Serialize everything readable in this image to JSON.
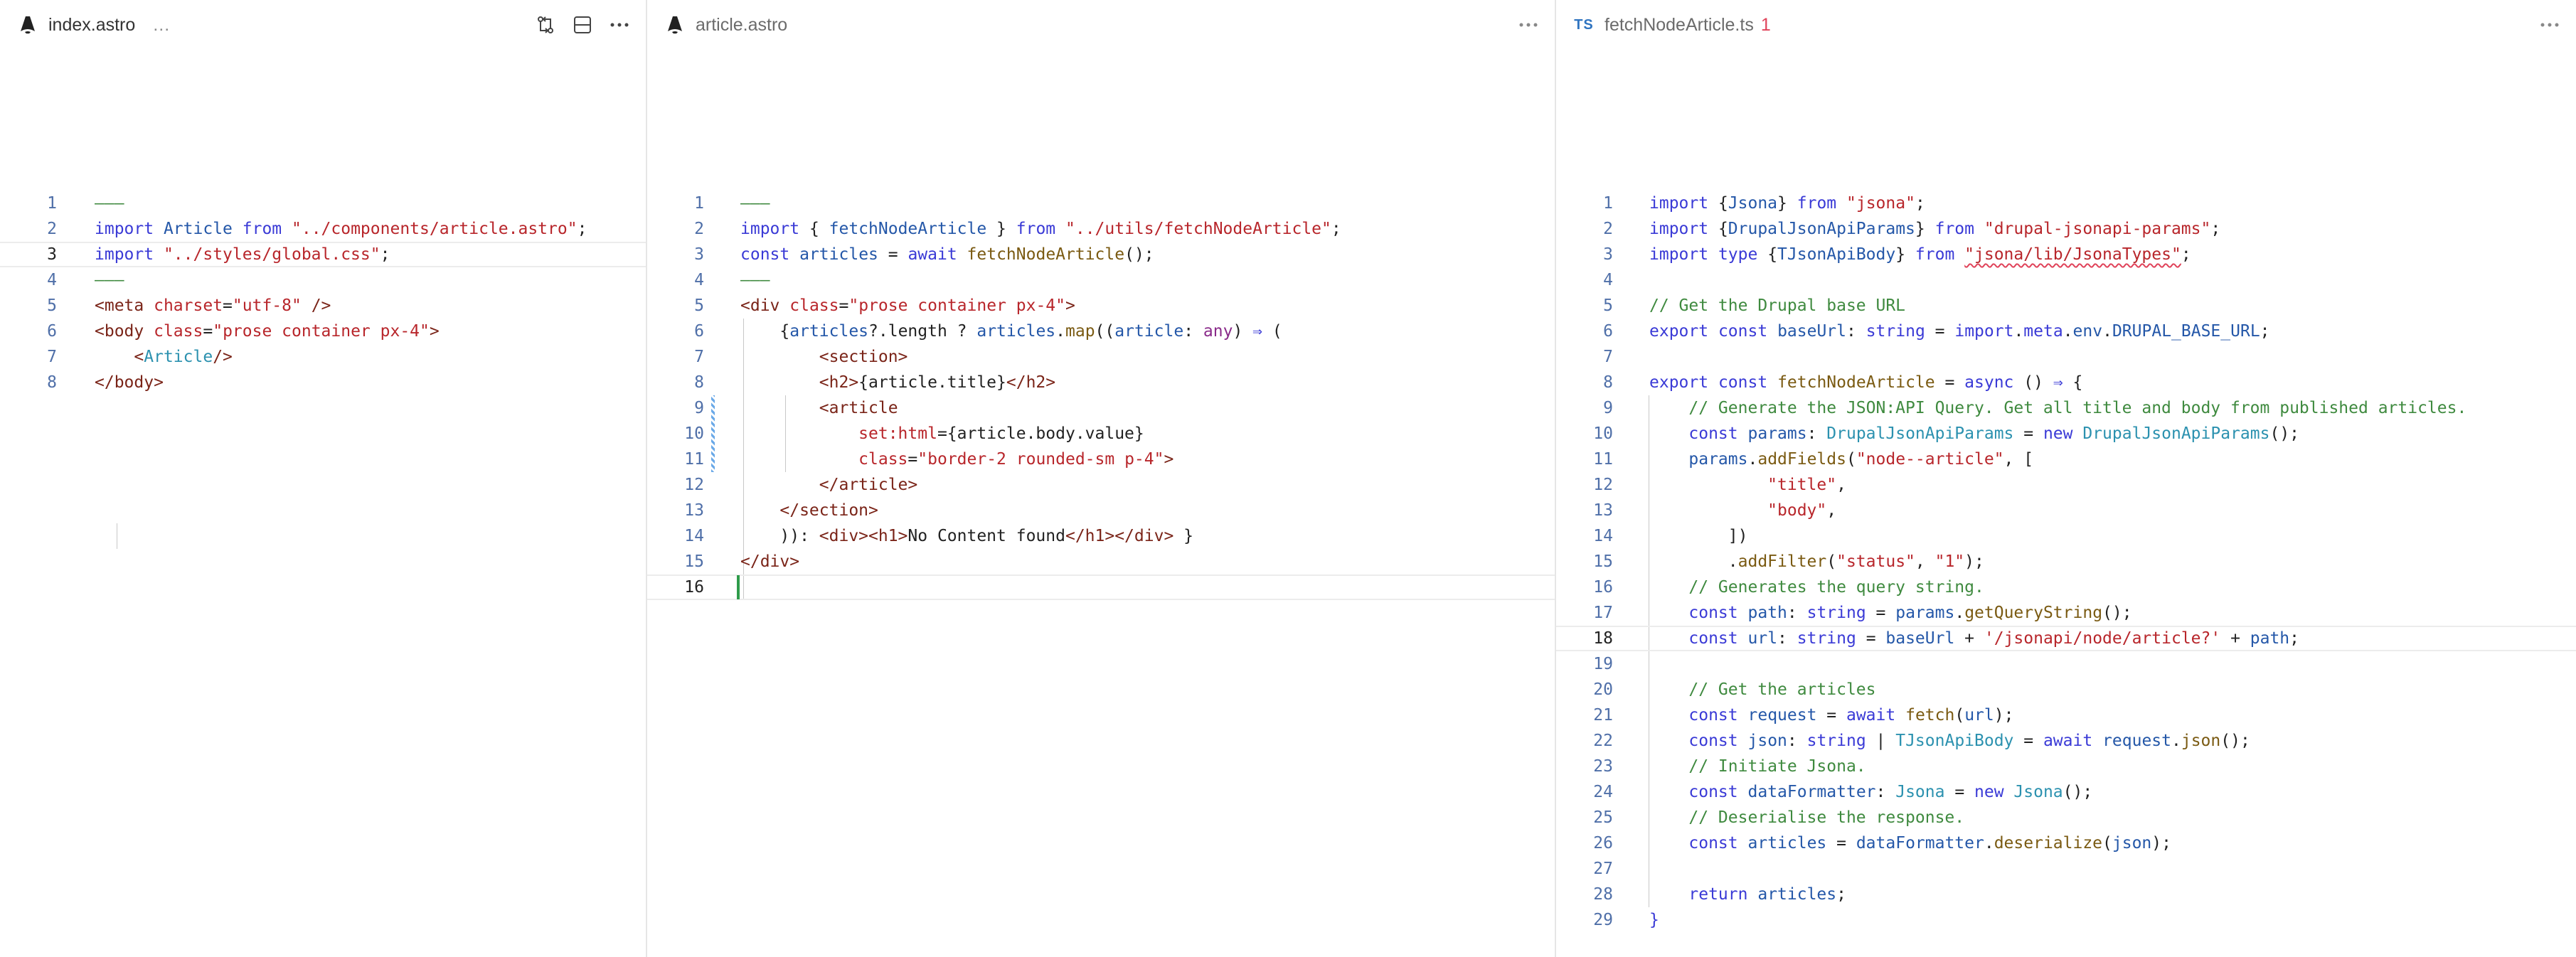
{
  "panes": [
    {
      "tab": {
        "title": "index.astro",
        "ellipsis": "…",
        "icon": "astro-icon"
      },
      "actions": [
        "source-control-compare-icon",
        "split-editor-icon",
        "more-actions-icon"
      ],
      "lines": [
        {
          "n": "1",
          "t": "———"
        },
        {
          "n": "2",
          "t": "import Article from \"../components/article.astro\";"
        },
        {
          "n": "3",
          "t": "import \"../styles/global.css\";"
        },
        {
          "n": "4",
          "t": "———"
        },
        {
          "n": "5",
          "t": "<meta charset=\"utf-8\" />"
        },
        {
          "n": "6",
          "t": "<body class=\"prose container px-4\">"
        },
        {
          "n": "7",
          "t": "    <Article/>"
        },
        {
          "n": "8",
          "t": "</body>"
        }
      ]
    },
    {
      "tab": {
        "title": "article.astro",
        "icon": "astro-icon"
      },
      "actions": [
        "more-actions-icon"
      ],
      "lines": [
        {
          "n": "1",
          "t": "———"
        },
        {
          "n": "2",
          "t": "import { fetchNodeArticle } from \"../utils/fetchNodeArticle\";"
        },
        {
          "n": "3",
          "t": "const articles = await fetchNodeArticle();"
        },
        {
          "n": "4",
          "t": "———"
        },
        {
          "n": "5",
          "t": "<div class=\"prose container px-4\">"
        },
        {
          "n": "6",
          "t": "    {articles?.length ? articles.map((article: any) ⇒ ("
        },
        {
          "n": "7",
          "t": "        <section>"
        },
        {
          "n": "8",
          "t": "        <h2>{article.title}</h2>"
        },
        {
          "n": "9",
          "t": "        <article"
        },
        {
          "n": "10",
          "t": "            set:html={article.body.value}"
        },
        {
          "n": "11",
          "t": "            class=\"border-2 rounded-sm p-4\">"
        },
        {
          "n": "12",
          "t": "        </article>"
        },
        {
          "n": "13",
          "t": "    </section>"
        },
        {
          "n": "14",
          "t": "    )): <div><h1>No Content found</h1></div> }"
        },
        {
          "n": "15",
          "t": "</div>"
        },
        {
          "n": "16",
          "t": ""
        }
      ]
    },
    {
      "tab": {
        "title": "fetchNodeArticle.ts",
        "badge": "TS",
        "problems": "1"
      },
      "actions": [
        "more-actions-icon"
      ],
      "lines": [
        {
          "n": "1",
          "t": "import {Jsona} from \"jsona\";"
        },
        {
          "n": "2",
          "t": "import {DrupalJsonApiParams} from \"drupal-jsonapi-params\";"
        },
        {
          "n": "3",
          "t": "import type {TJsonApiBody} from \"jsona/lib/JsonaTypes\";"
        },
        {
          "n": "4",
          "t": ""
        },
        {
          "n": "5",
          "t": "// Get the Drupal base URL"
        },
        {
          "n": "6",
          "t": "export const baseUrl: string = import.meta.env.DRUPAL_BASE_URL;"
        },
        {
          "n": "7",
          "t": ""
        },
        {
          "n": "8",
          "t": "export const fetchNodeArticle = async () ⇒ {"
        },
        {
          "n": "9",
          "t": "    // Generate the JSON:API Query. Get all title and body from published articles."
        },
        {
          "n": "10",
          "t": "    const params: DrupalJsonApiParams = new DrupalJsonApiParams();"
        },
        {
          "n": "11",
          "t": "    params.addFields(\"node--article\", ["
        },
        {
          "n": "12",
          "t": "            \"title\","
        },
        {
          "n": "13",
          "t": "            \"body\","
        },
        {
          "n": "14",
          "t": "        ])"
        },
        {
          "n": "15",
          "t": "        .addFilter(\"status\", \"1\");"
        },
        {
          "n": "16",
          "t": "    // Generates the query string."
        },
        {
          "n": "17",
          "t": "    const path: string = params.getQueryString();"
        },
        {
          "n": "18",
          "t": "    const url: string = baseUrl + '/jsonapi/node/article?' + path;"
        },
        {
          "n": "19",
          "t": ""
        },
        {
          "n": "20",
          "t": "    // Get the articles"
        },
        {
          "n": "21",
          "t": "    const request = await fetch(url);"
        },
        {
          "n": "22",
          "t": "    const json: string | TJsonApiBody = await request.json();"
        },
        {
          "n": "23",
          "t": "    // Initiate Jsona."
        },
        {
          "n": "24",
          "t": "    const dataFormatter: Jsona = new Jsona();"
        },
        {
          "n": "25",
          "t": "    // Deserialise the response."
        },
        {
          "n": "26",
          "t": "    const articles = dataFormatter.deserialize(json);"
        },
        {
          "n": "27",
          "t": ""
        },
        {
          "n": "28",
          "t": "    return articles;"
        },
        {
          "n": "29",
          "t": "}"
        }
      ]
    }
  ],
  "colors": {
    "accent_caret": "#2e9b4a",
    "error": "#e0435a",
    "line_numbers": "#4f6fa8"
  }
}
